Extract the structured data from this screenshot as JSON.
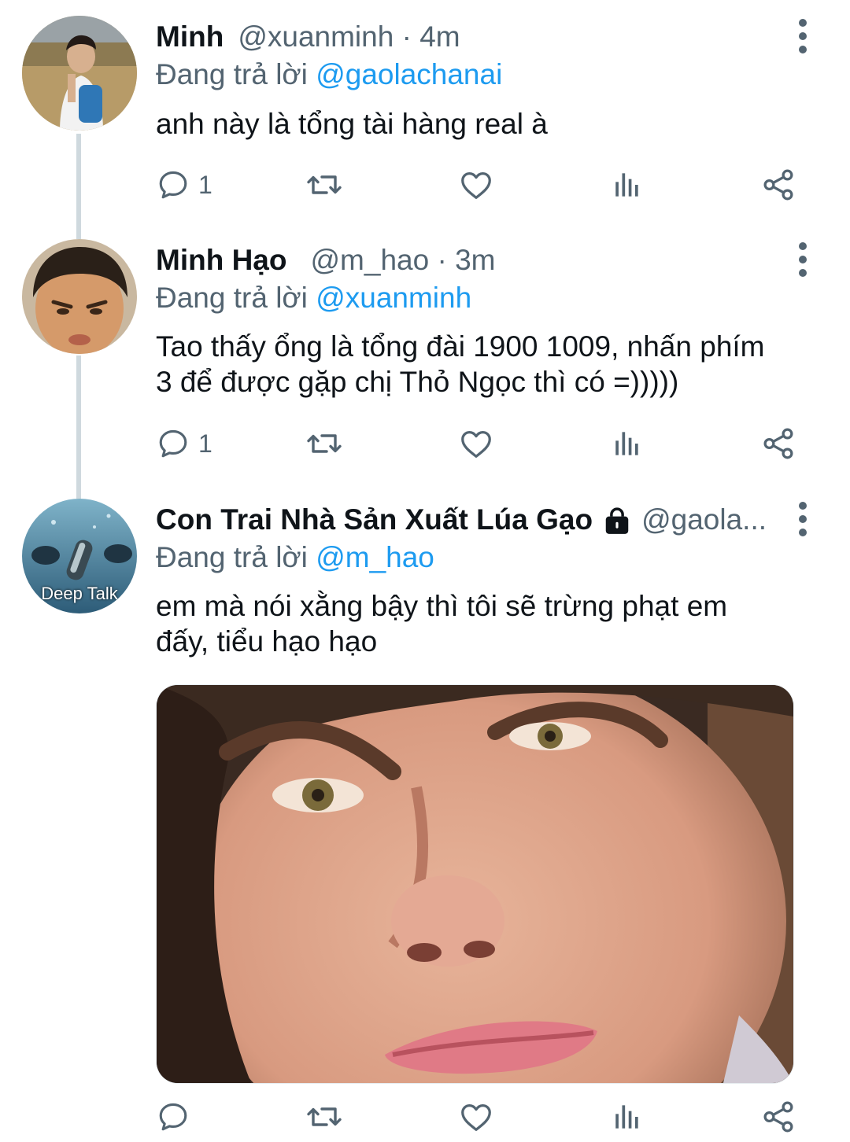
{
  "tweets": [
    {
      "name": "Minh",
      "handle": "@xuanminh",
      "separator": "·",
      "time": "4m",
      "replying_prefix": "Đang trả lời",
      "replying_to": "@gaolachanai",
      "text": "anh này là tổng tài hàng real à",
      "reply_count": "1",
      "icons": [
        "reply-icon",
        "retweet-icon",
        "like-icon",
        "analytics-icon",
        "share-icon",
        "more-icon"
      ]
    },
    {
      "name": "Minh Hạo",
      "handle": "@m_hao",
      "separator": "·",
      "time": "3m",
      "replying_prefix": "Đang trả lời",
      "replying_to": "@xuanminh",
      "text_line1": "Tao thấy ổng là tổng đài 1900 1009, nhấn phím",
      "text_line2": "3 để được gặp chị Thỏ Ngọc thì có =)))))",
      "reply_count": "1",
      "icons": [
        "reply-icon",
        "retweet-icon",
        "like-icon",
        "analytics-icon",
        "share-icon",
        "more-icon"
      ]
    },
    {
      "name": "Con Trai Nhà Sản Xuất Lúa Gạo",
      "handle": "@gaola...",
      "replying_prefix": "Đang trả lời",
      "replying_to": "@m_hao",
      "text_line1": "em mà nói xằng bậy thì tôi sẽ trừng phạt em",
      "text_line2": "đấy, tiểu hạo hạo",
      "avatar_caption": "Deep Talk",
      "icons": [
        "lock-icon",
        "reply-icon",
        "retweet-icon",
        "like-icon",
        "analytics-icon",
        "share-icon",
        "more-icon"
      ]
    }
  ],
  "colors": {
    "link": "#1d9bf0",
    "secondary_text": "#536471",
    "primary_text": "#0f1419",
    "thread_line": "#cfd9de"
  }
}
